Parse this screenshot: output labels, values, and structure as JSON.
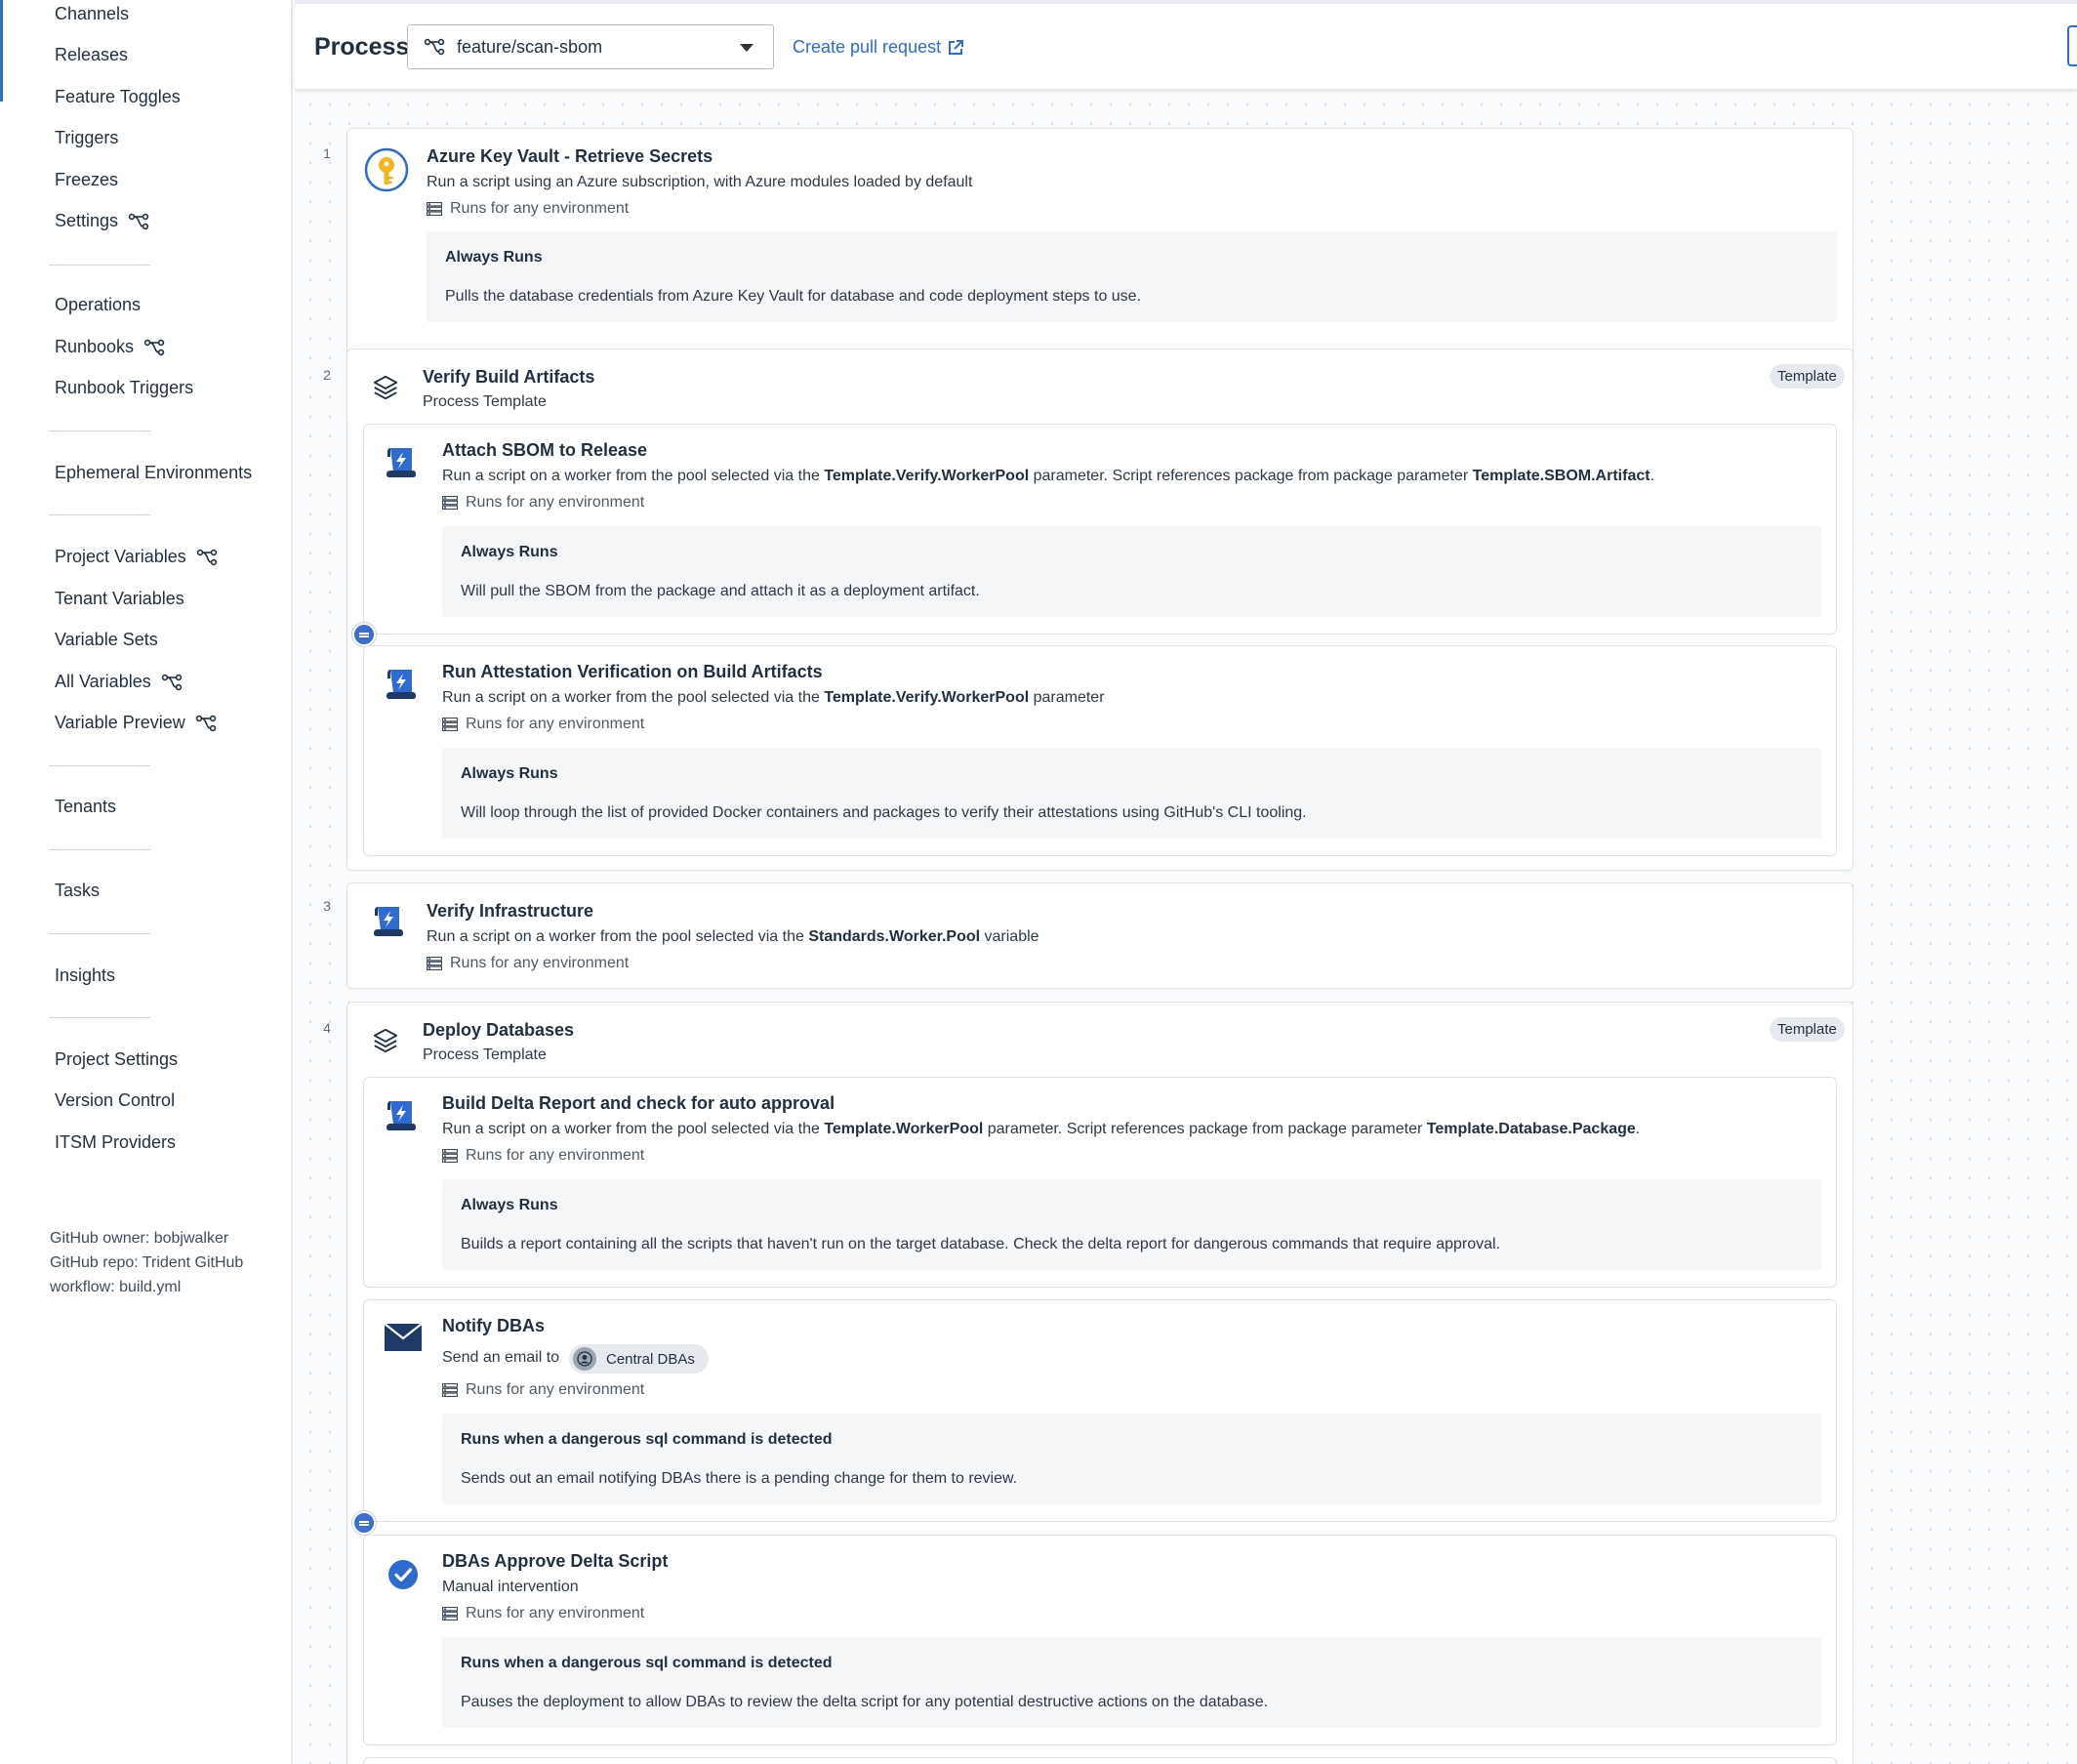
{
  "sidebar": {
    "items": [
      {
        "label": "Channels",
        "branch": false
      },
      {
        "label": "Releases",
        "branch": false
      },
      {
        "label": "Feature Toggles",
        "branch": false
      },
      {
        "label": "Triggers",
        "branch": false
      },
      {
        "label": "Freezes",
        "branch": false
      },
      {
        "label": "Settings",
        "branch": true
      },
      {
        "label": "Operations",
        "branch": false
      },
      {
        "label": "Runbooks",
        "branch": true
      },
      {
        "label": "Runbook Triggers",
        "branch": false
      },
      {
        "label": "Ephemeral Environments",
        "branch": false
      },
      {
        "label": "Project Variables",
        "branch": true
      },
      {
        "label": "Tenant Variables",
        "branch": false
      },
      {
        "label": "Variable Sets",
        "branch": false
      },
      {
        "label": "All Variables",
        "branch": true
      },
      {
        "label": "Variable Preview",
        "branch": true
      },
      {
        "label": "Tenants",
        "branch": false
      },
      {
        "label": "Tasks",
        "branch": false
      },
      {
        "label": "Insights",
        "branch": false
      },
      {
        "label": "Project Settings",
        "branch": false
      },
      {
        "label": "Version Control",
        "branch": false
      },
      {
        "label": "ITSM Providers",
        "branch": false
      }
    ],
    "git_info": "GitHub owner: bobjwalker GitHub repo: Trident GitHub workflow: build.yml"
  },
  "header": {
    "title": "Process",
    "branch": "feature/scan-sbom",
    "create_pr": "Create pull request"
  },
  "colors": {
    "accent": "#2f6ad0",
    "card_border": "#dde3e9",
    "note_bg": "#f4f6f8"
  },
  "common": {
    "runs_for": "Runs for any environment",
    "template_badge": "Template",
    "process_template": "Process Template"
  },
  "steps": [
    {
      "number": "1",
      "title": "Azure Key Vault - Retrieve Secrets",
      "description": "Run a script using an Azure subscription, with Azure modules loaded by default",
      "icon": "key-vault-icon",
      "note_title": "Always Runs",
      "note_body": "Pulls the database credentials from Azure Key Vault for database and code deployment steps to use."
    },
    {
      "number": "2",
      "title": "Verify Build Artifacts",
      "icon": "layers-icon",
      "children": [
        {
          "title": "Attach SBOM to Release",
          "desc_parts": [
            "Run a script on a worker from the pool selected via the ",
            "Template.Verify.WorkerPool",
            " parameter. Script references package from package parameter ",
            "Template.SBOM.Artifact",
            "."
          ],
          "icon": "script-icon",
          "note_title": "Always Runs",
          "note_body": "Will pull the SBOM from the package and attach it as a deployment artifact."
        },
        {
          "title": "Run Attestation Verification on Build Artifacts",
          "desc_parts": [
            "Run a script on a worker from the pool selected via the ",
            "Template.Verify.WorkerPool",
            " parameter"
          ],
          "icon": "script-icon",
          "note_title": "Always Runs",
          "note_body": "Will loop through the list of provided Docker containers and packages to verify their attestations using GitHub's CLI tooling."
        }
      ]
    },
    {
      "number": "3",
      "title": "Verify Infrastructure",
      "desc_parts": [
        "Run a script on a worker from the pool selected via the ",
        "Standards.Worker.Pool",
        " variable"
      ],
      "icon": "script-icon"
    },
    {
      "number": "4",
      "title": "Deploy Databases",
      "icon": "layers-icon",
      "children": [
        {
          "title": "Build Delta Report and check for auto approval",
          "desc_parts": [
            "Run a script on a worker from the pool selected via the ",
            "Template.WorkerPool",
            " parameter. Script references package from package parameter ",
            "Template.Database.Package",
            "."
          ],
          "icon": "script-icon",
          "note_title": "Always Runs",
          "note_body": "Builds a report containing all the scripts that haven't run on the target database. Check the delta report for dangerous commands that require approval."
        },
        {
          "title": "Notify DBAs",
          "description": "Send an email to",
          "recipient": "Central DBAs",
          "icon": "email-icon",
          "note_title": "Runs when a dangerous sql command is detected",
          "note_body": "Sends out an email notifying DBAs there is a pending change for them to review."
        },
        {
          "title": "DBAs Approve Delta Script",
          "description": "Manual intervention",
          "icon": "manual-intervention-icon",
          "note_title": "Runs when a dangerous sql command is detected",
          "note_body": "Pauses the deployment to allow DBAs to review the delta script for any potential destructive actions on the database."
        }
      ]
    }
  ]
}
